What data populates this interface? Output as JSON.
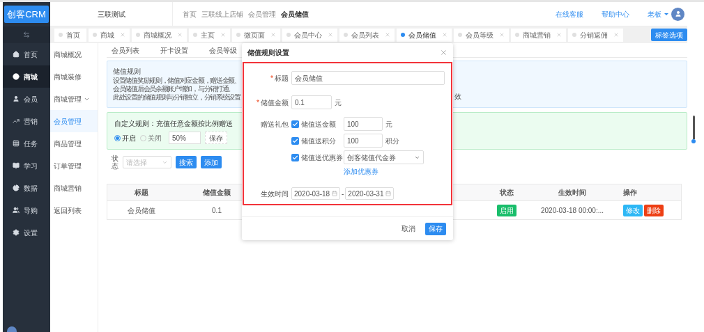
{
  "logo": "创客CRM",
  "shop_name": "三联测试",
  "breadcrumb": [
    {
      "label": "首页",
      "current": false
    },
    {
      "label": "三联线上店铺",
      "current": false
    },
    {
      "label": "会员管理",
      "current": false
    },
    {
      "label": "会员储值",
      "current": true
    }
  ],
  "header_links": [
    "在线客服",
    "帮助中心"
  ],
  "user": {
    "name": "老板"
  },
  "sidebar": {
    "items": [
      {
        "label": "首页",
        "selected": false
      },
      {
        "label": "商城",
        "selected": true
      },
      {
        "label": "会员",
        "selected": false
      },
      {
        "label": "营销",
        "selected": false
      },
      {
        "label": "任务",
        "selected": false
      },
      {
        "label": "学习",
        "selected": false
      },
      {
        "label": "数据",
        "selected": false
      },
      {
        "label": "导购",
        "selected": false
      },
      {
        "label": "设置",
        "selected": false
      }
    ]
  },
  "subsidebar": {
    "items": [
      {
        "label": "商城概况",
        "selected": false,
        "expandable": false
      },
      {
        "label": "商城装修",
        "selected": false,
        "expandable": false
      },
      {
        "label": "商城管理",
        "selected": false,
        "expandable": true
      },
      {
        "label": "会员管理",
        "selected": true,
        "expandable": false
      },
      {
        "label": "商品管理",
        "selected": false,
        "expandable": false
      },
      {
        "label": "订单管理",
        "selected": false,
        "expandable": false
      },
      {
        "label": "商城营销",
        "selected": false,
        "expandable": false
      },
      {
        "label": "返回列表",
        "selected": false,
        "expandable": false
      }
    ]
  },
  "tabs": [
    {
      "label": "首页",
      "selected": false,
      "closable": false
    },
    {
      "label": "商城",
      "selected": false,
      "closable": true
    },
    {
      "label": "商城概况",
      "selected": false,
      "closable": true
    },
    {
      "label": "主页",
      "selected": false,
      "closable": true
    },
    {
      "label": "微页面",
      "selected": false,
      "closable": true
    },
    {
      "label": "会员中心",
      "selected": false,
      "closable": true
    },
    {
      "label": "会员列表",
      "selected": false,
      "closable": true
    },
    {
      "label": "会员储值",
      "selected": true,
      "closable": true
    },
    {
      "label": "会员等级",
      "selected": false,
      "closable": true
    },
    {
      "label": "商城营销",
      "selected": false,
      "closable": true
    },
    {
      "label": "分销返佣",
      "selected": false,
      "closable": true
    }
  ],
  "tab_options_button": "标签选项",
  "sub_tabs": [
    "会员列表",
    "开卡设置",
    "会员等级"
  ],
  "info": {
    "title": "储值规则",
    "lines": [
      "设置储值奖励规则，储值对应金额，赠送金额、",
      "会员储值后会员余额账户增加，与分销打通。",
      "此处设置的储值规则与分销独立，分销系统设置"
    ],
    "tail": "效"
  },
  "custom_rule": {
    "title": "自定义规则：充值任意金额按比例赠送",
    "options": [
      {
        "label": "开启",
        "selected": true
      },
      {
        "label": "关闭",
        "selected": false
      }
    ],
    "value": "50%",
    "save": "保存"
  },
  "filter": {
    "label": "状态",
    "placeholder": "请选择",
    "search": "搜索",
    "add": "添加"
  },
  "table": {
    "columns": [
      "标题",
      "储值金额",
      "状态",
      "生效时间",
      "操作"
    ],
    "rows": [
      {
        "title": "会员储值",
        "amount": "0.1",
        "status": "启用",
        "time": "2020-03-18 00:00:...",
        "edit": "修改",
        "delete": "删除"
      }
    ]
  },
  "dialog": {
    "title": "储值规则设置",
    "fields": [
      {
        "label": "标题",
        "required_mark": "*",
        "value": "会员储值"
      },
      {
        "label": "储值金额",
        "required_mark": "*",
        "value": "0.1",
        "unit": "元"
      }
    ],
    "gift_label": "赠送礼包",
    "gifts": [
      {
        "kind": "input",
        "label": "储值送金额",
        "checked": true,
        "value": "100",
        "unit": "元"
      },
      {
        "kind": "input",
        "label": "储值送积分",
        "checked": true,
        "value": "100",
        "unit": "积分"
      },
      {
        "kind": "select",
        "label": "储值送优惠券",
        "checked": true,
        "value": "创客储值代金券",
        "link": "添加优惠券"
      }
    ],
    "date_label": "生效时间",
    "date_from": "2020-03-18",
    "date_sep": "-",
    "date_to": "2020-03-31",
    "cancel": "取消",
    "save": "保存"
  }
}
